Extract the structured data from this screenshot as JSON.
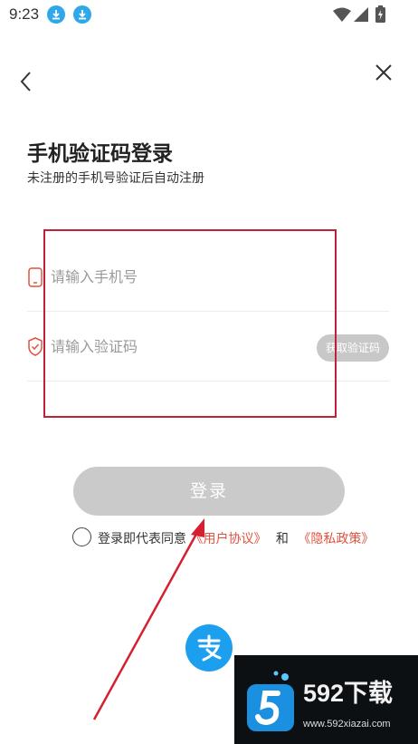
{
  "status_bar": {
    "time": "9:23",
    "icons": [
      "download-icon",
      "download-icon",
      "wifi-icon",
      "signal-icon",
      "battery-charging-icon"
    ]
  },
  "nav": {
    "back_icon": "chevron-left-icon",
    "close_icon": "close-icon"
  },
  "header": {
    "title": "手机验证码登录",
    "subtitle": "未注册的手机号验证后自动注册"
  },
  "form": {
    "phone": {
      "placeholder": "请输入手机号",
      "value": "",
      "icon": "phone-icon"
    },
    "code": {
      "placeholder": "请输入验证码",
      "value": "",
      "icon": "shield-icon",
      "get_code_label": "获取验证码"
    }
  },
  "login_button": {
    "label": "登录"
  },
  "agreement": {
    "prefix": "登录即代表同意",
    "user_agreement": "《用户协议》",
    "conjunction": "和",
    "privacy_policy": "《隐私政策》"
  },
  "footer": {
    "logo_icon": "alipay-logo-icon"
  },
  "watermark": {
    "brand": "592下载",
    "url": "www.592xiazai.com"
  },
  "colors": {
    "accent": "#e2523f",
    "button_disabled": "#cacaca",
    "annotation": "#c0213a",
    "alipay_blue": "#1d9ff0"
  }
}
